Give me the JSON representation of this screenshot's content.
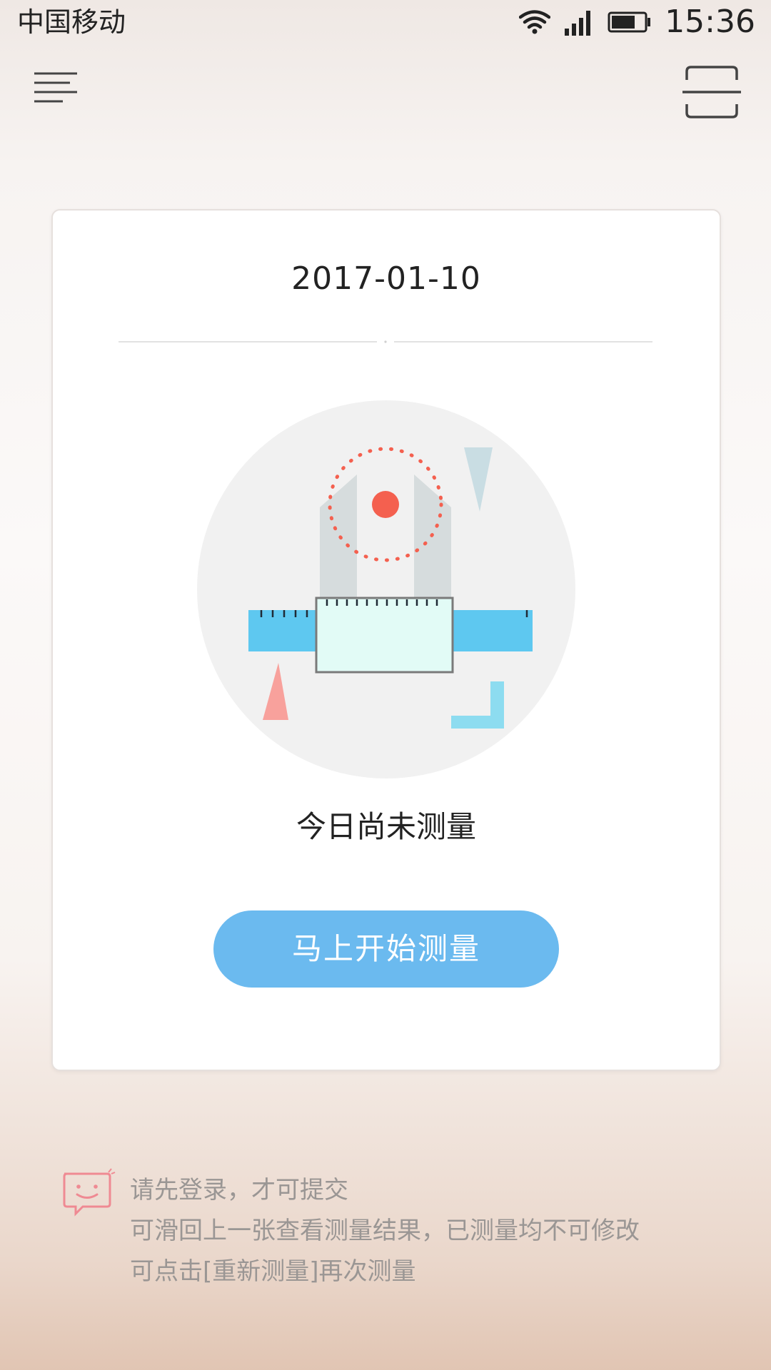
{
  "status_bar": {
    "carrier": "中国移动",
    "time": "15:36",
    "icons": [
      "wifi-icon",
      "signal-icon",
      "battery-icon"
    ]
  },
  "nav": {
    "menu_icon": "menu-icon",
    "scan_icon": "scan-icon"
  },
  "card": {
    "date": "2017-01-10",
    "status_message": "今日尚未测量",
    "start_button": "马上开始测量"
  },
  "tips": {
    "icon": "chat-smile-icon",
    "lines": [
      "请先登录，才可提交",
      "可滑回上一张查看测量结果，已测量均不可修改",
      "可点击[重新测量]再次测量"
    ]
  },
  "colors": {
    "button": "#6bbaef",
    "accent_red": "#f4604f",
    "ruler_blue": "#5ec8f0",
    "tip_pink": "#ef8a93"
  }
}
